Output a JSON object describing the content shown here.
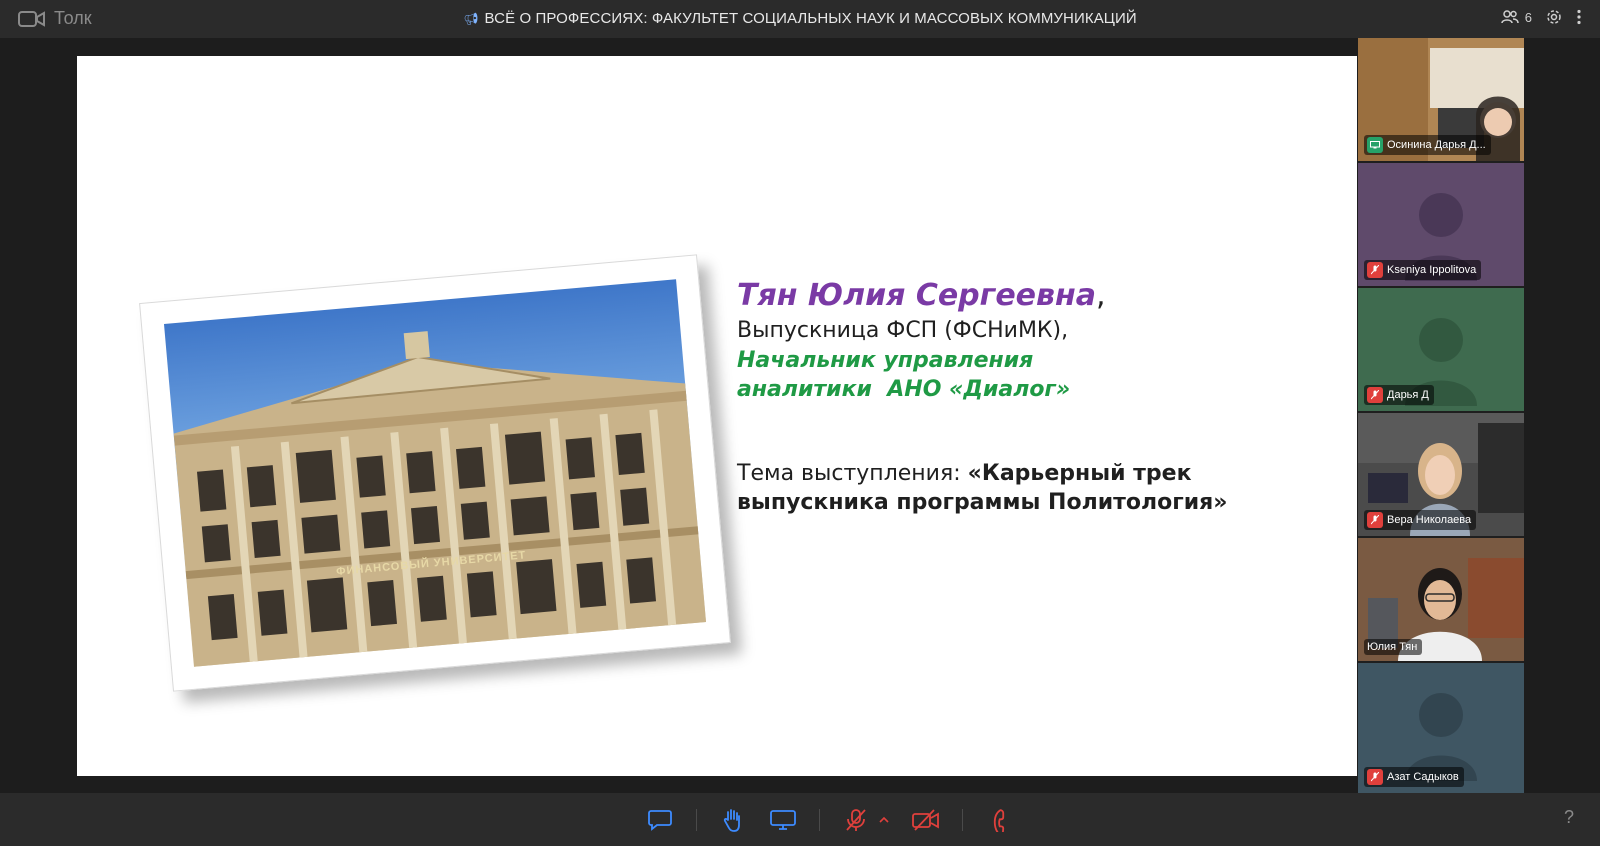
{
  "app": {
    "name": "Толк"
  },
  "header": {
    "title": "ВСЁ О ПРОФЕССИЯХ: ФАКУЛЬТЕТ СОЦИАЛЬНЫХ НАУК И МАССОВЫХ КОММУНИКАЦИЙ",
    "participants_count": "6",
    "icons": [
      "video-camera-icon",
      "megaphone-icon",
      "people-icon",
      "settings-icon",
      "more-vert-icon"
    ]
  },
  "slide": {
    "speaker_name": "Тян Юлия Сергеевна",
    "name_suffix": ",",
    "subtitle": "Выпускница ФСП (ФСНиМК),",
    "role_line1": "Начальник управления",
    "role_line2": "аналитики  АНО «Диалог»",
    "theme_label": "Тема выступления: ",
    "theme_title_part1": "«Карьерный трек",
    "theme_title_part2": "выпускника программы Политология»",
    "photo_sign": "ФИНАНСОВЫЙ УНИВЕРСИТЕТ",
    "colors": {
      "name": "#7a3aa5",
      "role": "#1f9a45"
    }
  },
  "participants": [
    {
      "name": "Осинина Дарья Д...",
      "status": "screen-share",
      "tile_color": "#8a6b45"
    },
    {
      "name": "Kseniya Ippolitova",
      "status": "muted",
      "tile_color": "#5f4a6b"
    },
    {
      "name": "Дарья Д",
      "status": "muted",
      "tile_color": "#3f6b4f"
    },
    {
      "name": "Вера Николаева",
      "status": "muted",
      "tile_color": "#3a3a3a"
    },
    {
      "name": "Юлия Тян",
      "status": "speaking",
      "tile_color": "#6b5240"
    },
    {
      "name": "Азат Садыков",
      "status": "muted",
      "tile_color": "#3f5663"
    }
  ],
  "controls": {
    "items": [
      "chat-icon",
      "raise-hand-icon",
      "screen-share-icon",
      "mic-off-icon",
      "chevron-up-icon",
      "camera-off-icon",
      "hang-up-icon"
    ],
    "help": "?"
  }
}
